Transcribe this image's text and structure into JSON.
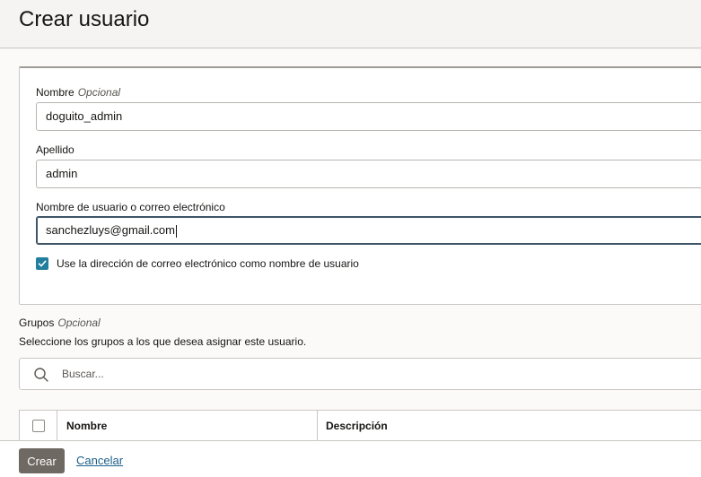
{
  "page": {
    "title": "Crear usuario"
  },
  "form": {
    "first_name": {
      "label": "Nombre",
      "optional": "Opcional",
      "value": "doguito_admin"
    },
    "last_name": {
      "label": "Apellido",
      "value": "admin"
    },
    "username": {
      "label": "Nombre de usuario o correo electrónico",
      "value": "sanchezluys@gmail.com"
    },
    "use_email_checkbox": {
      "label": "Use la dirección de correo electrónico como nombre de usuario",
      "checked": true
    }
  },
  "groups": {
    "label": "Grupos",
    "optional": "Opcional",
    "description": "Seleccione los grupos a los que desea asignar este usuario.",
    "search_placeholder": "Buscar...",
    "columns": [
      "Nombre",
      "Descripción"
    ]
  },
  "footer": {
    "create_label": "Crear",
    "cancel_label": "Cancelar"
  },
  "colors": {
    "checkbox_accent": "#227e9e",
    "primary_button": "#6f6964",
    "link": "#1b5f8a"
  }
}
